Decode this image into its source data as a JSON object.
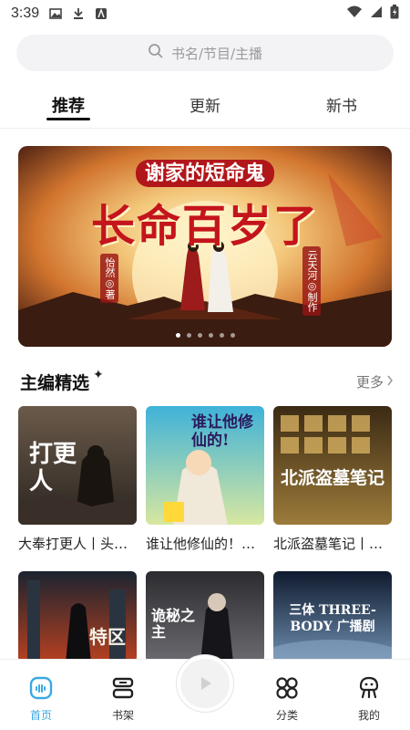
{
  "status": {
    "time": "3:39"
  },
  "search": {
    "placeholder": "书名/节目/主播",
    "icon": "search-icon"
  },
  "tabs": [
    {
      "label": "推荐",
      "active": true
    },
    {
      "label": "更新",
      "active": false
    },
    {
      "label": "新书",
      "active": false
    }
  ],
  "banner": {
    "subtitle": "谢家的短命鬼",
    "title": "长命百岁了",
    "author_tag": "怡然◎著",
    "studio_tag": "云天河◎制作",
    "dots": 6,
    "active_dot": 0
  },
  "section": {
    "title": "主编精选",
    "more_label": "更多"
  },
  "books": [
    {
      "title": "大奉打更人丨头部大咖IP",
      "cover_text": "打更人",
      "colors": [
        "#6b5a4a",
        "#2a2520"
      ]
    },
    {
      "title": "谁让他修仙的！有声剧",
      "cover_text": "谁让他修仙的!",
      "colors": [
        "#3fb2d9",
        "#d7e7a0"
      ]
    },
    {
      "title": "北派盗墓笔记丨老豹演播",
      "cover_text": "北派盗墓笔记",
      "colors": [
        "#3b2a14",
        "#9c7b3a"
      ]
    },
    {
      "title": "",
      "cover_text": "特区",
      "colors": [
        "#1b2430",
        "#b84020"
      ]
    },
    {
      "title": "",
      "cover_text": "诡秘之主",
      "colors": [
        "#2c2c30",
        "#6a6a70"
      ]
    },
    {
      "title": "",
      "cover_text": "三体 THREE-BODY 广播剧",
      "colors": [
        "#0f1a2e",
        "#6f8fb0"
      ]
    }
  ],
  "nav": [
    {
      "label": "首页",
      "icon": "home-icon",
      "active": true
    },
    {
      "label": "书架",
      "icon": "bookshelf-icon",
      "active": false
    },
    {
      "label": "分类",
      "icon": "category-icon",
      "active": false
    },
    {
      "label": "我的",
      "icon": "profile-icon",
      "active": false
    }
  ],
  "colors": {
    "accent": "#3aa9e0",
    "highlight": "#c7eefc"
  }
}
